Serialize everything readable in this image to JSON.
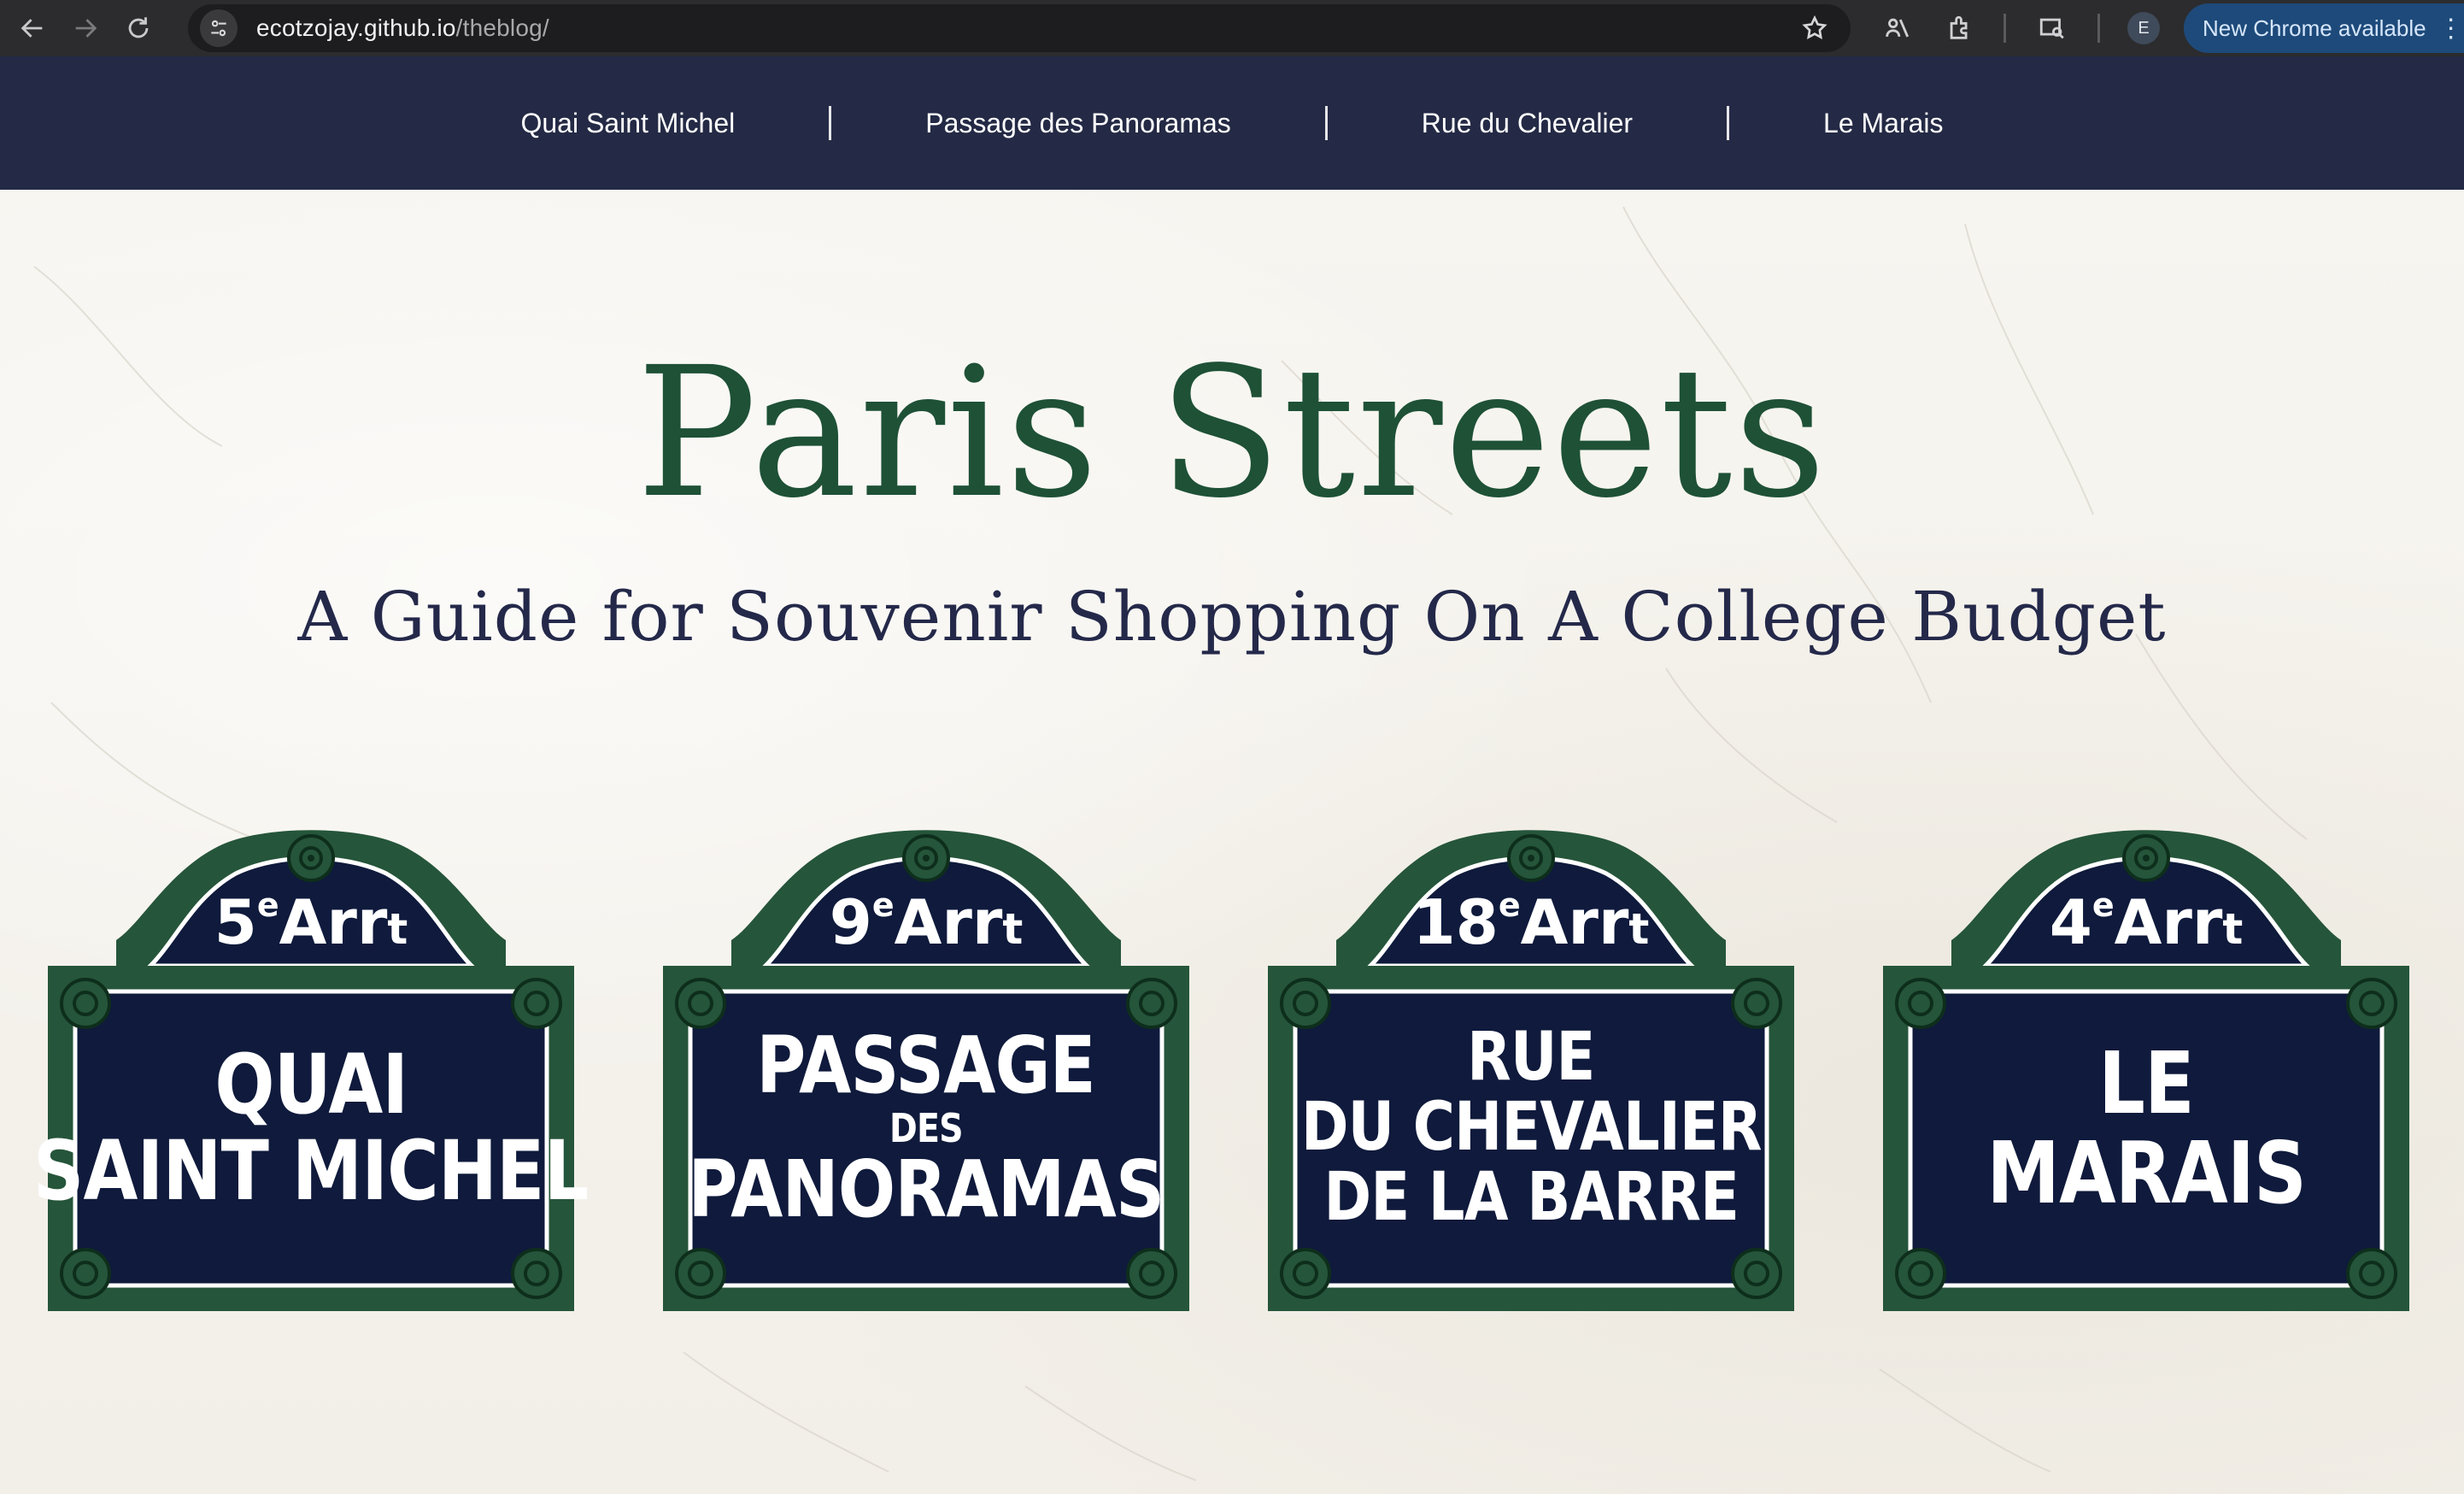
{
  "browser": {
    "url_host": "ecotzojay.github.io",
    "url_path": "/theblog/",
    "profile_initial": "E",
    "update_label": "New Chrome available",
    "icons": [
      "back-icon",
      "forward-icon",
      "reload-icon",
      "site-info-icon",
      "star-icon",
      "no-tracking-icon",
      "extensions-icon",
      "tab-search-icon",
      "more-icon"
    ]
  },
  "nav": {
    "links": [
      {
        "label": "Quai Saint Michel"
      },
      {
        "label": "Passage des Panoramas"
      },
      {
        "label": "Rue du Chevalier"
      },
      {
        "label": "Le Marais"
      }
    ]
  },
  "hero": {
    "title": "Paris Streets",
    "subtitle": "A Guide for Souvenir Shopping On A College Budget"
  },
  "signs": [
    {
      "arr_number": "5",
      "arr_sup": "e",
      "arr_word": "Arr",
      "arr_t": "t",
      "lines": [
        "QUAI",
        "SAINT MICHEL"
      ]
    },
    {
      "arr_number": "9",
      "arr_sup": "e",
      "arr_word": "Arr",
      "arr_t": "t",
      "lines": [
        "PASSAGE",
        "DES",
        "PANORAMAS"
      ]
    },
    {
      "arr_number": "18",
      "arr_sup": "e",
      "arr_word": "Arr",
      "arr_t": "t",
      "lines": [
        "RUE",
        "DU CHEVALIER",
        "DE LA BARRE"
      ]
    },
    {
      "arr_number": "4",
      "arr_sup": "e",
      "arr_word": "Arr",
      "arr_t": "t",
      "lines": [
        "LE",
        "MARAIS"
      ]
    }
  ],
  "colors": {
    "nav_bg": "#242a45",
    "title_green": "#1e5136",
    "subtitle_navy": "#24294a",
    "sign_green": "#25553a",
    "sign_navy": "#0f1a3c"
  }
}
